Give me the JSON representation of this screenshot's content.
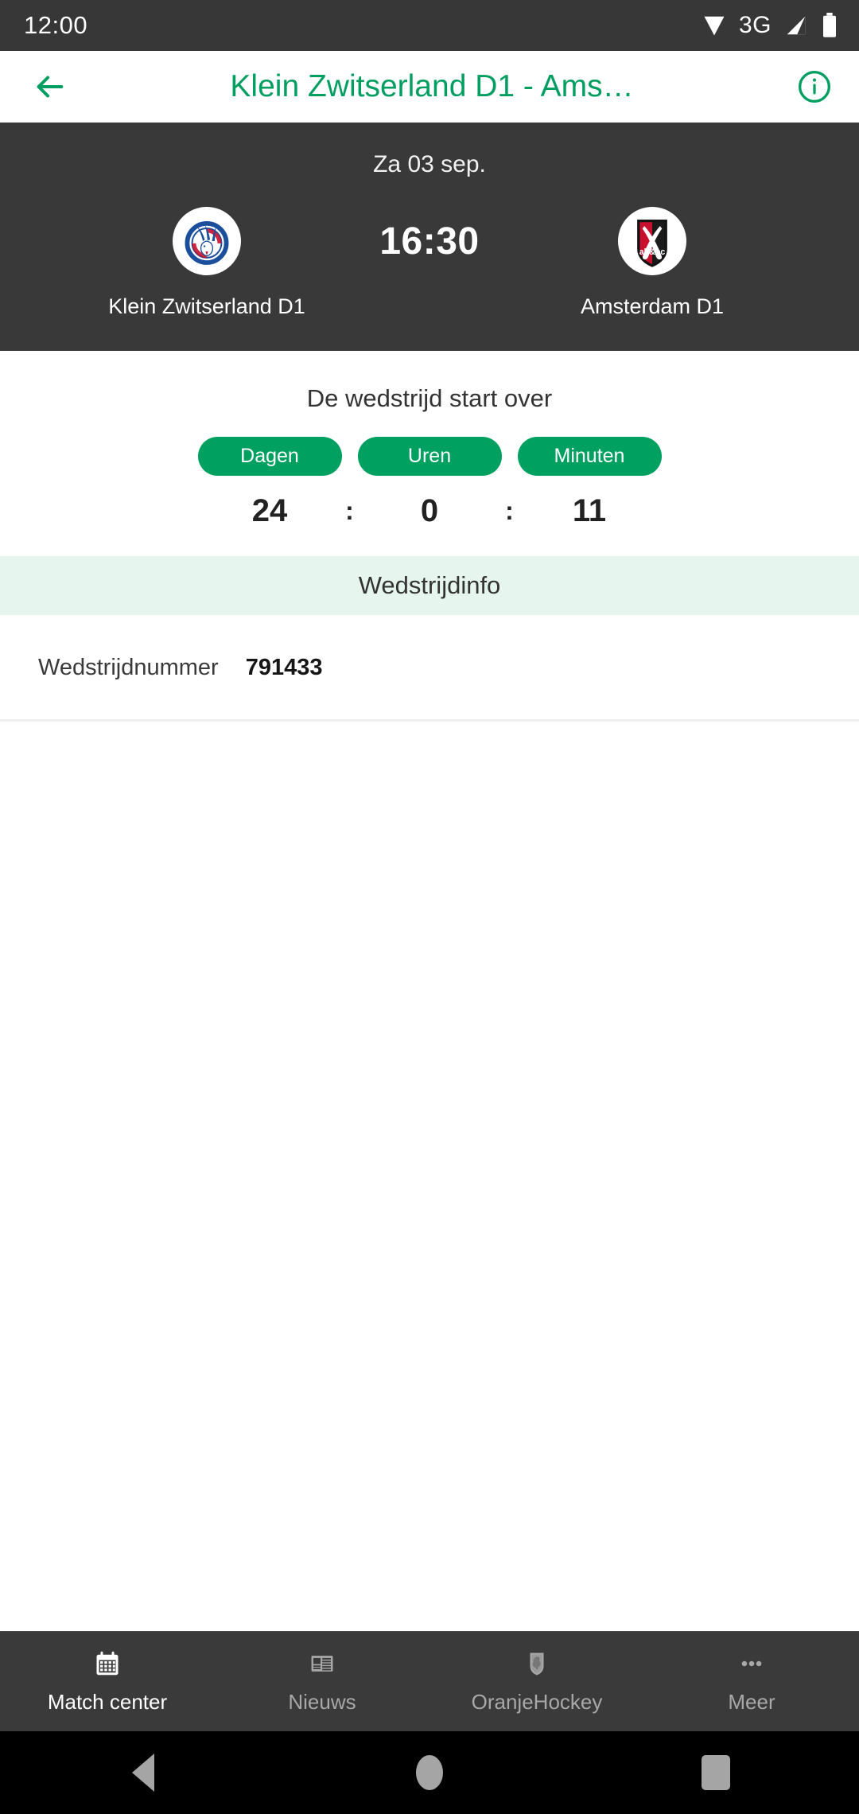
{
  "status_bar": {
    "time": "12:00",
    "network": "3G",
    "icons": [
      "wifi-icon",
      "signal-icon",
      "battery-icon"
    ]
  },
  "app_bar": {
    "back_icon": "arrow-left-icon",
    "title": "Klein Zwitserland D1 - Ams…",
    "info_icon": "info-circle-icon",
    "accent_color": "#009E60"
  },
  "match_banner": {
    "date": "Za 03 sep.",
    "kickoff_time": "16:30",
    "background_color": "#393939",
    "home_team": {
      "name": "Klein Zwitserland D1",
      "crest": "klein-zwitserland-crest"
    },
    "away_team": {
      "name": "Amsterdam D1",
      "crest": "amsterdam-ahbc-crest"
    }
  },
  "countdown": {
    "title": "De wedstrijd start over",
    "pill_color": "#00A060",
    "units": [
      {
        "label": "Dagen",
        "value": "24"
      },
      {
        "label": "Uren",
        "value": "0"
      },
      {
        "label": "Minuten",
        "value": "11"
      }
    ],
    "separator": ":"
  },
  "match_info": {
    "section_title": "Wedstrijdinfo",
    "section_bg": "#E6F5EE",
    "rows": [
      {
        "label": "Wedstrijdnummer",
        "value": "791433"
      }
    ]
  },
  "bottom_nav": {
    "items": [
      {
        "label": "Match center",
        "icon": "calendar-icon",
        "active": true
      },
      {
        "label": "Nieuws",
        "icon": "newspaper-icon",
        "active": false
      },
      {
        "label": "OranjeHockey",
        "icon": "lion-shield-icon",
        "active": false
      },
      {
        "label": "Meer",
        "icon": "ellipsis-icon",
        "active": false
      }
    ]
  },
  "system_nav": {
    "back": "system-back-icon",
    "home": "system-home-icon",
    "recents": "system-recents-icon"
  }
}
